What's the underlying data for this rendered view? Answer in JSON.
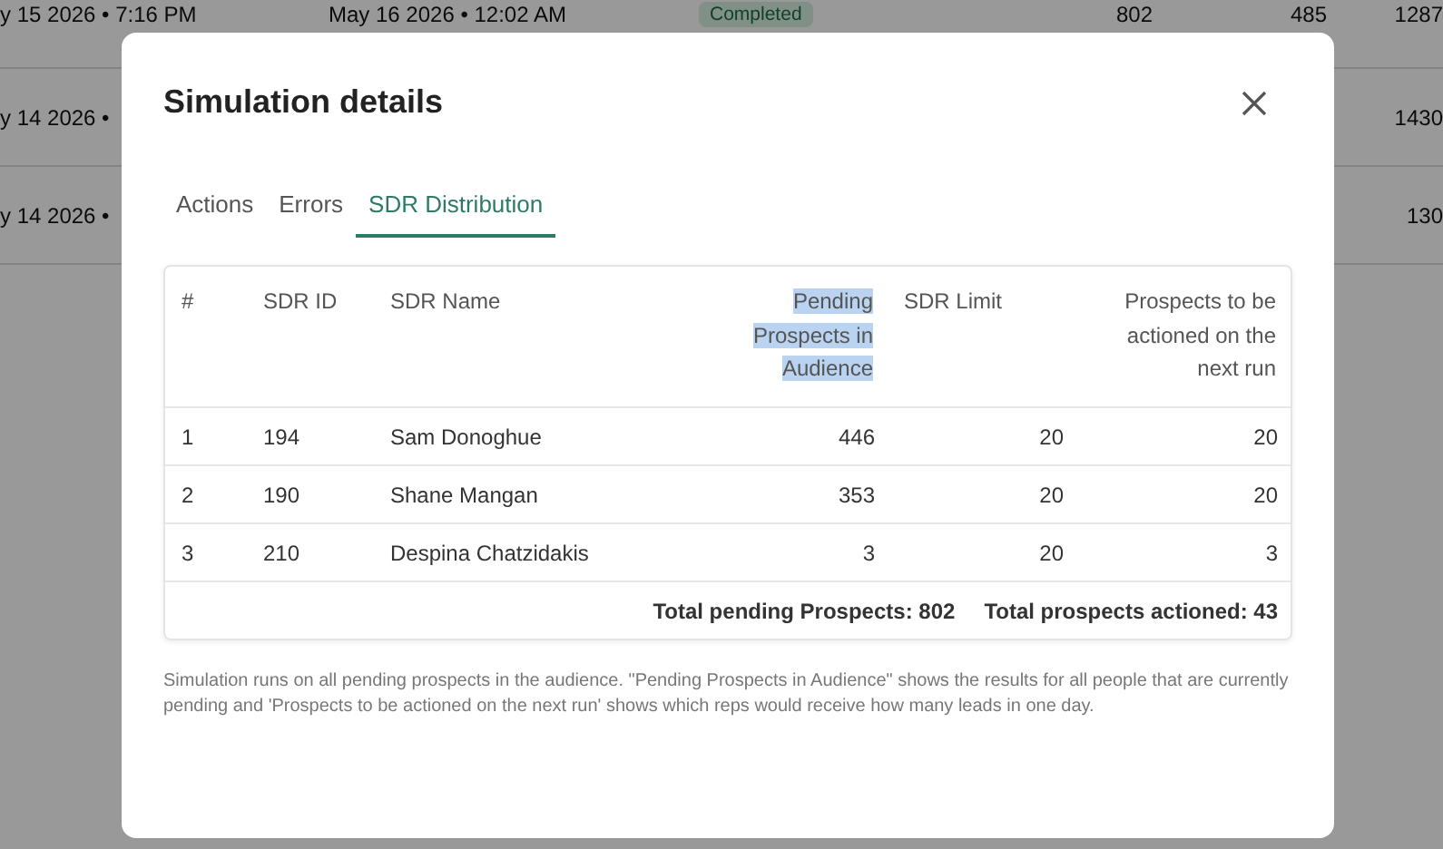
{
  "background_table": {
    "rows": [
      {
        "cells": [
          "y 15 2026 • 7:16 PM",
          "May 16 2026 • 12:02 AM",
          "Completed",
          "802",
          "485",
          "1287"
        ]
      },
      {
        "cells": [
          "y 14 2026 •",
          "",
          "",
          "",
          "",
          "1430"
        ]
      },
      {
        "cells": [
          "y 14 2026 •",
          "",
          "",
          "",
          "",
          "130"
        ]
      }
    ]
  },
  "dialog": {
    "title": "Simulation details",
    "tabs": [
      {
        "label": "Actions",
        "selected": false
      },
      {
        "label": "Errors",
        "selected": false
      },
      {
        "label": "SDR Distribution",
        "selected": true
      }
    ],
    "table": {
      "columns": [
        {
          "label": "#",
          "highlighted": false
        },
        {
          "label": "SDR ID",
          "highlighted": false
        },
        {
          "label": "SDR Name",
          "highlighted": false
        },
        {
          "label": "Pending Prospects in Audience",
          "highlighted": true
        },
        {
          "label": "SDR Limit",
          "highlighted": false
        },
        {
          "label": "Prospects to be actioned on the next run",
          "highlighted": false
        }
      ],
      "rows": [
        {
          "cells": [
            "1",
            "194",
            "Sam Donoghue",
            "446",
            "20",
            "20"
          ]
        },
        {
          "cells": [
            "2",
            "190",
            "Shane Mangan",
            "353",
            "20",
            "20"
          ]
        },
        {
          "cells": [
            "3",
            "210",
            "Despina Chatzidakis",
            "3",
            "20",
            "3"
          ]
        }
      ],
      "totals": [
        "Total pending Prospects: 802",
        "Total prospects actioned: 43"
      ]
    },
    "note": "Simulation runs on all pending prospects in the audience. \"Pending Prospects in Audience\" shows the results for all people that are currently pending and 'Prospects to be actioned on the next run' shows which reps would receive how many leads in one day."
  }
}
